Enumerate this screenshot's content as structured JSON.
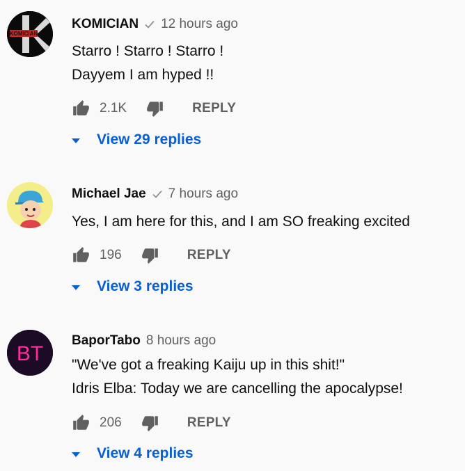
{
  "comments": [
    {
      "author": "KOMICIAN",
      "verified": true,
      "time": "12 hours ago",
      "lines": [
        "Starro ! Starro ! Starro !",
        "Dayyem I am hyped !!"
      ],
      "likes": "2.1K",
      "reply_label": "REPLY",
      "view_replies": "View 29 replies",
      "avatar_text": "KOMICIAN",
      "avatar_icon": "komician-avatar"
    },
    {
      "author": "Michael Jae",
      "verified": true,
      "time": "7 hours ago",
      "lines": [
        "Yes, I am here for this, and I am SO freaking excited"
      ],
      "likes": "196",
      "reply_label": "REPLY",
      "view_replies": "View 3 replies",
      "avatar_icon": "cartoon-boy-avatar"
    },
    {
      "author": "BaporTabo",
      "verified": false,
      "time": "8 hours ago",
      "lines": [
        "\"We've got a freaking Kaiju up in this shit!\"",
        "Idris Elba: Today we are cancelling the apocalypse!"
      ],
      "likes": "206",
      "reply_label": "REPLY",
      "view_replies": "View 4 replies",
      "avatar_text": "BT",
      "avatar_icon": "bt-neon-avatar"
    }
  ],
  "colors": {
    "background": "#f9f9f9",
    "link": "#065fd4",
    "secondary_text": "#606060",
    "neon_pink": "#ff2d9b"
  }
}
